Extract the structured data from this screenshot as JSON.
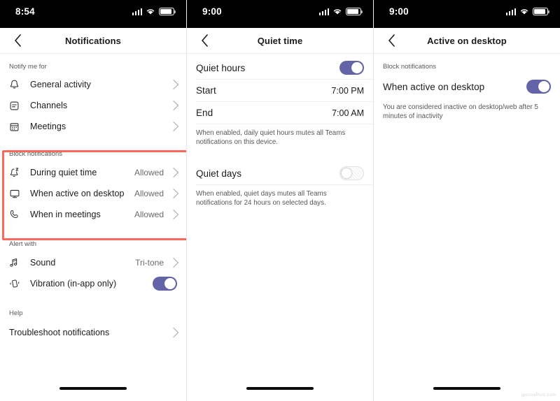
{
  "phones": [
    {
      "status": {
        "time": "8:54",
        "signal_icon": "cellular-signal-icon",
        "wifi_icon": "wifi-icon",
        "battery_icon": "battery-icon"
      },
      "nav": {
        "back_icon": "chevron-left-icon",
        "title": "Notifications"
      },
      "sections": [
        {
          "label": "Notify me for",
          "rows": [
            {
              "icon": "bell-icon",
              "label": "General activity",
              "value": "",
              "accessory": "chevron"
            },
            {
              "icon": "channels-icon",
              "label": "Channels",
              "value": "",
              "accessory": "chevron"
            },
            {
              "icon": "calendar-icon",
              "label": "Meetings",
              "value": "",
              "accessory": "chevron"
            }
          ]
        },
        {
          "label": "Block notifications",
          "highlighted": true,
          "rows": [
            {
              "icon": "bell-quiet-icon",
              "label": "During quiet time",
              "value": "Allowed",
              "accessory": "chevron"
            },
            {
              "icon": "monitor-icon",
              "label": "When active on desktop",
              "value": "Allowed",
              "accessory": "chevron"
            },
            {
              "icon": "phone-icon",
              "label": "When in meetings",
              "value": "Allowed",
              "accessory": "chevron"
            }
          ]
        },
        {
          "label": "Alert with",
          "rows": [
            {
              "icon": "music-note-icon",
              "label": "Sound",
              "value": "Tri-tone",
              "accessory": "chevron"
            },
            {
              "icon": "vibration-icon",
              "label": "Vibration (in-app only)",
              "value": "",
              "accessory": "toggle-on"
            }
          ]
        },
        {
          "label": "Help",
          "rows": [
            {
              "icon": "",
              "label": "Troubleshoot notifications",
              "value": "",
              "accessory": "chevron"
            }
          ]
        }
      ],
      "watermark": ""
    },
    {
      "status": {
        "time": "9:00",
        "signal_icon": "cellular-signal-icon",
        "wifi_icon": "wifi-icon",
        "battery_icon": "battery-icon"
      },
      "nav": {
        "back_icon": "chevron-left-icon",
        "title": "Quiet time"
      },
      "rows": [
        {
          "label": "Quiet hours",
          "value": "",
          "accessory": "toggle-on"
        },
        {
          "label": "Start",
          "value": "7:00 PM",
          "accessory": "none"
        },
        {
          "label": "End",
          "value": "7:00 AM",
          "accessory": "none"
        }
      ],
      "help_1": "When enabled, daily quiet hours mutes all Teams notifications on this device.",
      "rows_2": [
        {
          "label": "Quiet days",
          "value": "",
          "accessory": "toggle-off"
        }
      ],
      "help_2": "When enabled, quiet days mutes all Teams notifications for 24 hours on selected days.",
      "watermark": ""
    },
    {
      "status": {
        "time": "9:00",
        "signal_icon": "cellular-signal-icon",
        "wifi_icon": "wifi-icon",
        "battery_icon": "battery-icon"
      },
      "nav": {
        "back_icon": "chevron-left-icon",
        "title": "Active on desktop"
      },
      "section_label": "Block notifications",
      "rows": [
        {
          "label": "When active on desktop",
          "value": "",
          "accessory": "toggle-on"
        }
      ],
      "help_1": "You are considered inactive on desktop/web after 5 minutes of inactivity",
      "watermark": "groovyPost.com"
    }
  ],
  "colors": {
    "toggle_on": "#6264a7",
    "highlight": "#fb685c",
    "status_bar": "#000000",
    "divider": "#ececec",
    "secondary_text": "#6b6b6b"
  }
}
